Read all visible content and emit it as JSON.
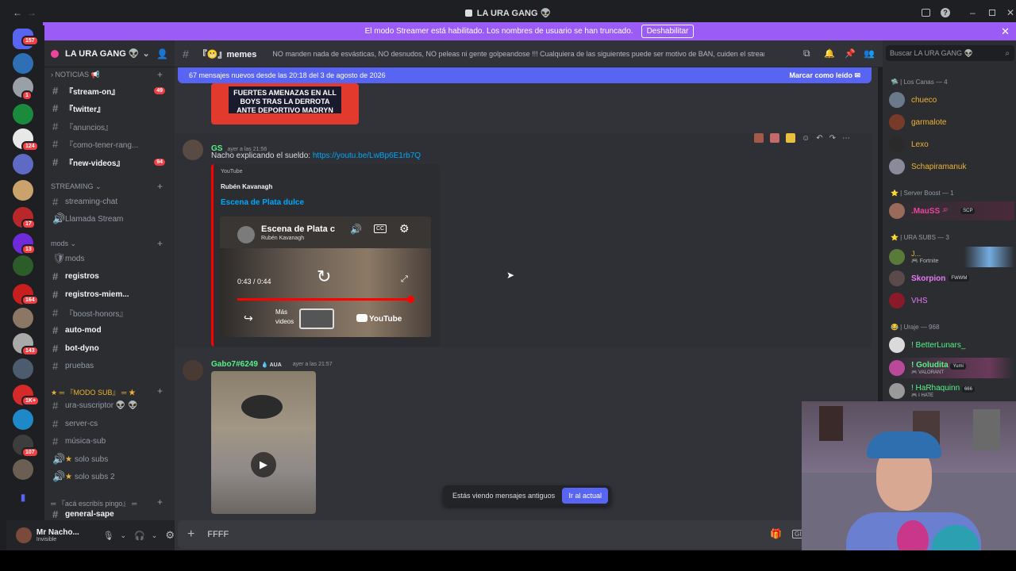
{
  "window": {
    "title": "LA URA GANG 👽",
    "back": "←",
    "forward": "→"
  },
  "banner": {
    "text": "El modo Streamer está habilitado. Los nombres de usuario se han truncado.",
    "button": "Deshabilitar",
    "close": "✕"
  },
  "guild_badges": [
    "157",
    "1",
    "124",
    "17",
    "13",
    "164",
    "143",
    "1K+",
    "107"
  ],
  "server": {
    "name": "LA URA GANG 👽"
  },
  "categories": {
    "noticias": "NOTICIAS 📢",
    "streaming": "STREAMING",
    "mods": "mods",
    "modosub": "『MODO SUB』",
    "acaescribis": "『acá escribís pingo』"
  },
  "channels": [
    {
      "name": "『stream-on』",
      "badge": "49"
    },
    {
      "name": "『twitter』",
      "badge": ""
    },
    {
      "name": "『anuncios』",
      "badge": ""
    },
    {
      "name": "『como-tener-rang...",
      "badge": ""
    },
    {
      "name": "『new-videos』",
      "badge": "94"
    },
    {
      "name": "streaming-chat",
      "badge": ""
    },
    {
      "name": "Llamada Stream",
      "badge": ""
    },
    {
      "name": "mods",
      "badge": ""
    },
    {
      "name": "registros",
      "badge": ""
    },
    {
      "name": "registros-miem...",
      "badge": ""
    },
    {
      "name": "『boost-honors』",
      "badge": ""
    },
    {
      "name": "auto-mod",
      "badge": ""
    },
    {
      "name": "bot-dyno",
      "badge": ""
    },
    {
      "name": "pruebas",
      "badge": ""
    },
    {
      "name": "ura-suscriptor 👽 👽",
      "badge": ""
    },
    {
      "name": "server-cs",
      "badge": ""
    },
    {
      "name": "música-sub",
      "badge": ""
    },
    {
      "name": "solo subs",
      "badge": ""
    },
    {
      "name": "solo subs 2",
      "badge": ""
    },
    {
      "name": "general-sape",
      "badge": ""
    }
  ],
  "user": {
    "name": "Mr Nacho...",
    "status": "Invisible"
  },
  "chat_header": {
    "channel": "memes",
    "topic": "NO manden nada de esvásticas, NO desnudos, NO peleas ni gente golpeandose !!! Cualquiera de las siguientes puede ser motivo de BAN, cuiden el stream!"
  },
  "new_messages": {
    "text": "67 mensajes nuevos desde las 20:18 del 3 de agosto de 2026",
    "action": "Marcar como leído"
  },
  "prev_image_text": "FUERTES AMENAZAS EN ALL BOYS TRAS LA DERROTA ANTE DEPORTIVO MADRYN",
  "messages": [
    {
      "author": "GS",
      "time": "ayer a las 21:56",
      "text": "Nacho explicando el sueldo:",
      "link": "https://youtu.be/LwBp6E1rb7Q"
    },
    {
      "author": "Gabo7#6249",
      "tag": "AUA",
      "time": "ayer a las 21:57"
    }
  ],
  "embed": {
    "provider": "YouTube",
    "author": "Rubén Kavanagh",
    "title": "Escena de Plata dulce",
    "video_title": "Escena de Plata c",
    "video_channel": "Rubén Kavanagh",
    "time": "0:43 / 0:44",
    "more": "Más videos",
    "logo": "YouTube"
  },
  "composer": {
    "value": "FFFF"
  },
  "old_messages": {
    "text": "Estás viendo mensajes antiguos",
    "button": "Ir al actual"
  },
  "search": {
    "placeholder": "Buscar LA URA GANG 👽"
  },
  "member_groups": [
    {
      "label": "🛸 | Los Canas — 4"
    },
    {
      "label": "⭐ | Server Boost — 1"
    },
    {
      "label": "⭐ | URA SUBS — 3"
    },
    {
      "label": "😂 | Uraje — 968"
    }
  ],
  "members": [
    {
      "name": "chueco",
      "color": "#f0b232"
    },
    {
      "name": "garmalote",
      "color": "#f0b232"
    },
    {
      "name": "Lexo",
      "color": "#f0b232"
    },
    {
      "name": "Schapiramanuk",
      "color": "#f0b232"
    },
    {
      "name": ".MauSS",
      "color": "#eb459e"
    },
    {
      "name": "J...",
      "color": "#f0b232",
      "activity": "Fortnite"
    },
    {
      "name": "Skorpion",
      "color": "#e879f9"
    },
    {
      "name": "VHS",
      "color": "#e879f9"
    },
    {
      "name": "! BetterLunars_",
      "color": "#57f287"
    },
    {
      "name": "! Goludita",
      "color": "#57f287",
      "activity": "VALORANT"
    },
    {
      "name": "! HaRhaquinn",
      "color": "#57f287",
      "activity": "I HATE"
    }
  ],
  "member_tags": {
    "mauss_jp": "JP",
    "mauss_scp": "SCP",
    "skorpion_tag": "FWWM",
    "goludita_tag": "Yumi",
    "harhaquinn_tag": "666"
  }
}
